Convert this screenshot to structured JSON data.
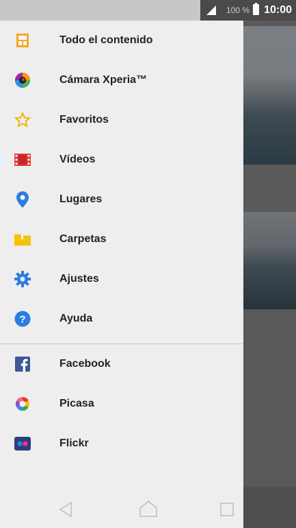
{
  "status": {
    "battery_pct": "100 %",
    "time": "10:00"
  },
  "menu_primary": [
    {
      "label": "Todo el contenido",
      "icon": "all-content-icon"
    },
    {
      "label": "Cámara Xperia™",
      "icon": "camera-icon"
    },
    {
      "label": "Favoritos",
      "icon": "star-icon"
    },
    {
      "label": "Vídeos",
      "icon": "film-icon"
    },
    {
      "label": "Lugares",
      "icon": "location-pin-icon"
    },
    {
      "label": "Carpetas",
      "icon": "folder-icon"
    },
    {
      "label": "Ajustes",
      "icon": "gear-icon"
    },
    {
      "label": "Ayuda",
      "icon": "help-icon"
    }
  ],
  "menu_services": [
    {
      "label": "Facebook",
      "icon": "facebook-icon"
    },
    {
      "label": "Picasa",
      "icon": "picasa-icon"
    },
    {
      "label": "Flickr",
      "icon": "flickr-icon"
    }
  ],
  "colors": {
    "drawer_bg": "#eeeeee",
    "accent_orange": "#f5a623",
    "gear_blue": "#2a7de1",
    "facebook_blue": "#3b5998",
    "film_red": "#e53935",
    "folder_yellow": "#f4c20d"
  }
}
